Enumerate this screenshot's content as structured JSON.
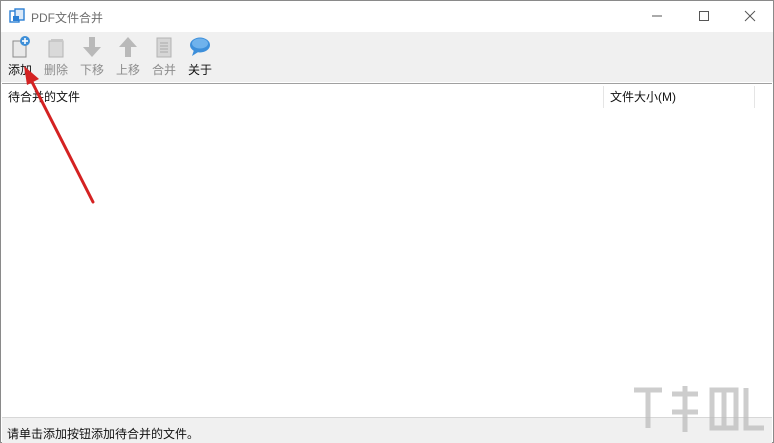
{
  "window": {
    "title": "PDF文件合并",
    "controls": {
      "minimize": "minimize-icon",
      "maximize": "maximize-icon",
      "close": "close-icon"
    }
  },
  "toolbar": {
    "items": [
      {
        "label": "添加",
        "icon": "add-file-icon",
        "enabled": true
      },
      {
        "label": "删除",
        "icon": "delete-file-icon",
        "enabled": false
      },
      {
        "label": "下移",
        "icon": "arrow-down-icon",
        "enabled": false
      },
      {
        "label": "上移",
        "icon": "arrow-up-icon",
        "enabled": false
      },
      {
        "label": "合并",
        "icon": "merge-icon",
        "enabled": false
      },
      {
        "label": "关于",
        "icon": "speech-bubble-icon",
        "enabled": true
      }
    ]
  },
  "list": {
    "columns": [
      "待合并的文件",
      "文件大小(M)"
    ],
    "rows": []
  },
  "status": {
    "text": "请单击添加按钮添加待合并的文件。"
  },
  "colors": {
    "accent_blue": "#2b7fd4",
    "annotation_arrow": "#d42222",
    "toolbar_bg": "#f0f0f0"
  }
}
